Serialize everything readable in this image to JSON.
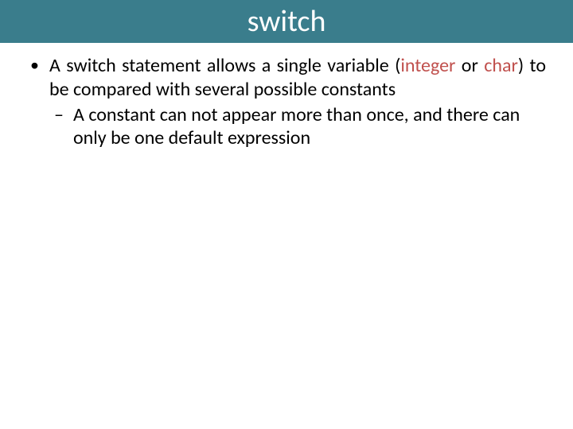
{
  "title": "switch",
  "bullet": {
    "pre": "A switch statement allows a single variable (",
    "hl1": "integer",
    "mid": " or ",
    "hl2": "char",
    "post": ") to be compared with several possible constants"
  },
  "sub": "A constant can not appear more than once, and there can only be one default expression"
}
